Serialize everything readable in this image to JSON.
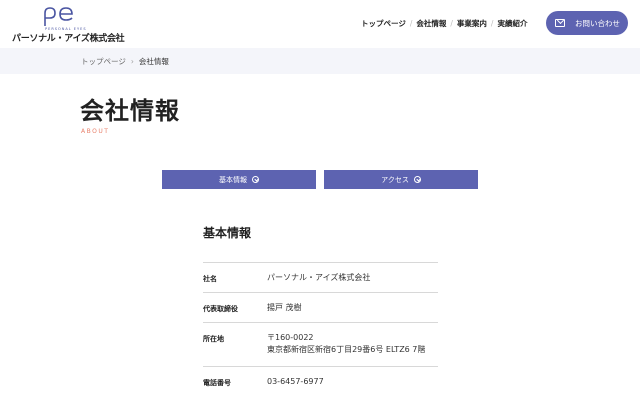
{
  "header": {
    "logo_sub": "PERSONAL EYES",
    "logo_text": "パーソナル・アイズ株式会社",
    "nav": [
      {
        "label": "トップページ"
      },
      {
        "label": "会社情報"
      },
      {
        "label": "事業案内"
      },
      {
        "label": "実績紹介"
      }
    ],
    "nav_separator": "/",
    "contact_label": "お問い合わせ"
  },
  "breadcrumb": {
    "home": "トップページ",
    "separator": "›",
    "current": "会社情報"
  },
  "page": {
    "title": "会社情報",
    "subtitle": "ABOUT"
  },
  "tabs": [
    {
      "label": "基本情報"
    },
    {
      "label": "アクセス"
    }
  ],
  "section": {
    "title": "基本情報",
    "rows": [
      {
        "label": "社名",
        "value": "パーソナル・アイズ株式会社"
      },
      {
        "label": "代表取締役",
        "value": "揚戸 茂樹"
      },
      {
        "label": "所在地",
        "value": "〒160-0022",
        "value2": "東京都新宿区新宿6丁目29番6号 ELTZ6 7階"
      },
      {
        "label": "電話番号",
        "value": "03-6457-6977"
      }
    ]
  },
  "colors": {
    "accent": "#5d63b1",
    "subtitle": "#e8806b",
    "breadcrumb_bg": "#f4f5fa"
  }
}
